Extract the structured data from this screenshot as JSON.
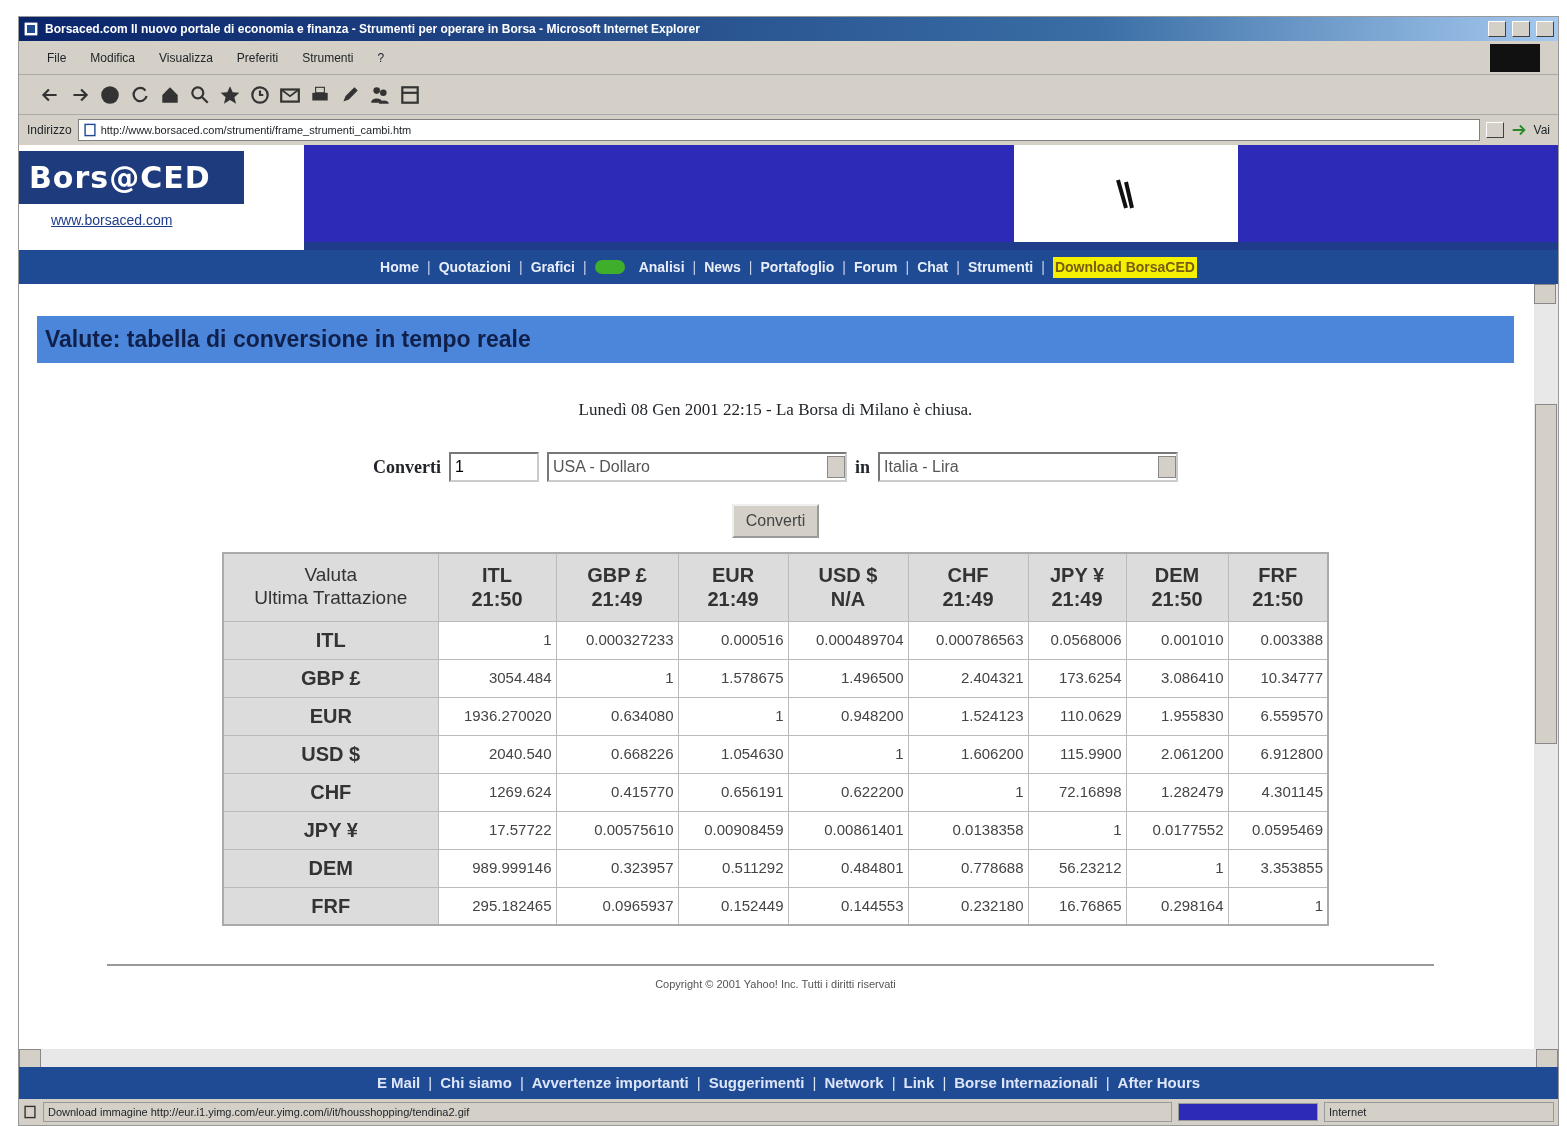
{
  "window": {
    "title": "Borsaced.com Il nuovo portale di economia e finanza - Strumenti per operare in Borsa - Microsoft Internet Explorer"
  },
  "menu": [
    "File",
    "Modifica",
    "Visualizza",
    "Preferiti",
    "Strumenti",
    "?"
  ],
  "address": {
    "label": "Indirizzo",
    "url": "http://www.borsaced.com/strumenti/frame_strumenti_cambi.htm",
    "go": "Vai"
  },
  "site": {
    "logo": "Bors@CED",
    "domain": "www.borsaced.com"
  },
  "nav": {
    "separator": "|",
    "items": [
      {
        "label": "Home",
        "kind": "link"
      },
      {
        "label": "Quotazioni",
        "kind": "link"
      },
      {
        "label": "Grafici",
        "kind": "link"
      },
      {
        "label": "Analisi",
        "kind": "badge-link"
      },
      {
        "label": "News",
        "kind": "link"
      },
      {
        "label": "Portafoglio",
        "kind": "link"
      },
      {
        "label": "Forum",
        "kind": "link"
      },
      {
        "label": "Chat",
        "kind": "link"
      },
      {
        "label": "Strumenti",
        "kind": "link"
      },
      {
        "label": "Download BorsaCED",
        "kind": "download"
      }
    ]
  },
  "heading": "Valute: tabella di conversione in tempo reale",
  "date_line": "Lunedì 08 Gen 2001 22:15 - La Borsa di Milano è chiusa.",
  "converter": {
    "label": "Converti",
    "amount": "1",
    "from": "USA - Dollaro",
    "joiner": "in",
    "to": "Italia - Lira",
    "button": "Converti"
  },
  "table": {
    "columns": [
      {
        "code": "Valuta",
        "time": "Ultima Trattazione"
      },
      {
        "code": "ITL",
        "time": "21:50"
      },
      {
        "code": "GBP £",
        "time": "21:49"
      },
      {
        "code": "EUR",
        "time": "21:49"
      },
      {
        "code": "USD $",
        "time": "N/A"
      },
      {
        "code": "CHF",
        "time": "21:49"
      },
      {
        "code": "JPY ¥",
        "time": "21:49"
      },
      {
        "code": "DEM",
        "time": "21:50"
      },
      {
        "code": "FRF",
        "time": "21:50"
      }
    ],
    "rows": [
      {
        "cells": [
          "ITL",
          "1",
          "0.000327233",
          "0.000516",
          "0.000489704",
          "0.000786563",
          "0.0568006",
          "0.001010",
          "0.003388"
        ]
      },
      {
        "cells": [
          "GBP £",
          "3054.484",
          "1",
          "1.578675",
          "1.496500",
          "2.404321",
          "173.6254",
          "3.086410",
          "10.34777"
        ]
      },
      {
        "cells": [
          "EUR",
          "1936.270020",
          "0.634080",
          "1",
          "0.948200",
          "1.524123",
          "110.0629",
          "1.955830",
          "6.559570"
        ]
      },
      {
        "cells": [
          "USD $",
          "2040.540",
          "0.668226",
          "1.054630",
          "1",
          "1.606200",
          "115.9900",
          "2.061200",
          "6.912800"
        ]
      },
      {
        "cells": [
          "CHF",
          "1269.624",
          "0.415770",
          "0.656191",
          "0.622200",
          "1",
          "72.16898",
          "1.282479",
          "4.301145"
        ]
      },
      {
        "cells": [
          "JPY ¥",
          "17.57722",
          "0.00575610",
          "0.00908459",
          "0.00861401",
          "0.0138358",
          "1",
          "0.0177552",
          "0.0595469"
        ]
      },
      {
        "cells": [
          "DEM",
          "989.999146",
          "0.323957",
          "0.511292",
          "0.484801",
          "0.778688",
          "56.23212",
          "1",
          "3.353855"
        ]
      },
      {
        "cells": [
          "FRF",
          "295.182465",
          "0.0965937",
          "0.152449",
          "0.144553",
          "0.232180",
          "16.76865",
          "0.298164",
          "1"
        ]
      }
    ]
  },
  "copyright": "Copyright © 2001 Yahoo! Inc. Tutti i diritti riservati",
  "bottom_nav": {
    "separator": "|",
    "items": [
      "E Mail",
      "Chi siamo",
      "Avvertenze importanti",
      "Suggerimenti",
      "Network",
      "Link",
      "Borse Internazionali",
      "After Hours"
    ]
  },
  "status_bar": {
    "text": "Download immagine http://eur.i1.yimg.com/eur.yimg.com/i/it/housshopping/tendina2.gif",
    "zone": "Internet",
    "progress": {
      "level": 1
    }
  }
}
